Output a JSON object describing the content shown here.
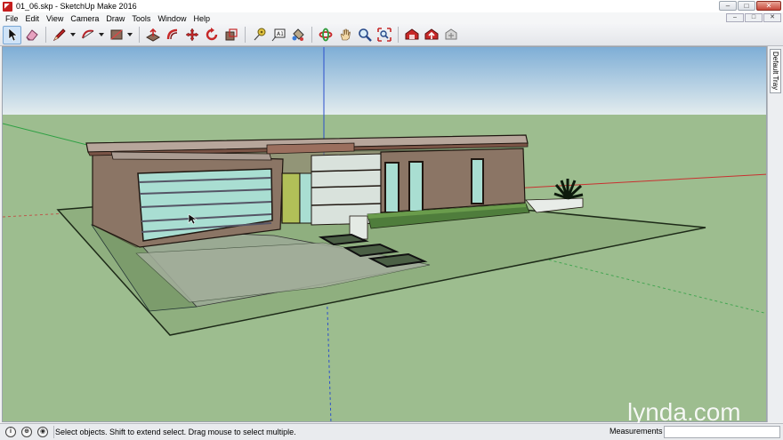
{
  "window": {
    "title": "01_06.skp - SketchUp Make 2016",
    "minimize_glyph": "–",
    "maximize_glyph": "□",
    "close_glyph": "✕"
  },
  "menu": {
    "items": [
      "File",
      "Edit",
      "View",
      "Camera",
      "Draw",
      "Tools",
      "Window",
      "Help"
    ]
  },
  "toolbar": {
    "tools": [
      {
        "name": "select-tool",
        "icon": "arrow-cursor-icon",
        "active": true
      },
      {
        "name": "eraser-tool",
        "icon": "eraser-icon"
      },
      {
        "name": "line-tool",
        "icon": "pencil-icon",
        "caret": true
      },
      {
        "name": "arc-tool",
        "icon": "arc-icon",
        "caret": true
      },
      {
        "name": "shape-tool",
        "icon": "rectangle-icon",
        "caret": true
      },
      {
        "name": "push-pull-tool",
        "icon": "push-pull-icon"
      },
      {
        "name": "offset-tool",
        "icon": "offset-icon"
      },
      {
        "name": "move-tool",
        "icon": "move-icon"
      },
      {
        "name": "rotate-tool",
        "icon": "rotate-icon"
      },
      {
        "name": "scale-tool",
        "icon": "scale-icon"
      },
      {
        "name": "tape-measure-tool",
        "icon": "tape-measure-icon"
      },
      {
        "name": "text-tool",
        "icon": "text-icon"
      },
      {
        "name": "paint-bucket-tool",
        "icon": "paint-bucket-icon"
      },
      {
        "name": "orbit-tool",
        "icon": "orbit-icon"
      },
      {
        "name": "pan-tool",
        "icon": "hand-icon"
      },
      {
        "name": "zoom-tool",
        "icon": "magnifier-icon"
      },
      {
        "name": "zoom-extents-tool",
        "icon": "zoom-extents-icon"
      },
      {
        "name": "warehouse-tool",
        "icon": "warehouse-icon"
      },
      {
        "name": "share-model-tool",
        "icon": "share-model-icon"
      },
      {
        "name": "extension-warehouse-tool",
        "icon": "extension-warehouse-icon"
      }
    ]
  },
  "tray": {
    "tab_label": "Default Tray"
  },
  "status": {
    "hint": "Select objects. Shift to extend select. Drag mouse to select multiple.",
    "measurements_label": "Measurements",
    "icon_info": "i",
    "icon_geo": "⊕",
    "icon_user": "◉"
  },
  "watermark": "lynda.com",
  "colors": {
    "sky_top": "#7fb0d8",
    "sky_bottom": "#dfe8ec",
    "ground": "#9cbc8f",
    "axis_red": "#cc2b2b",
    "axis_green": "#2ea043",
    "axis_blue": "#2b4fcc",
    "wall": "#8b7566",
    "glass": "#a8dcd0"
  }
}
